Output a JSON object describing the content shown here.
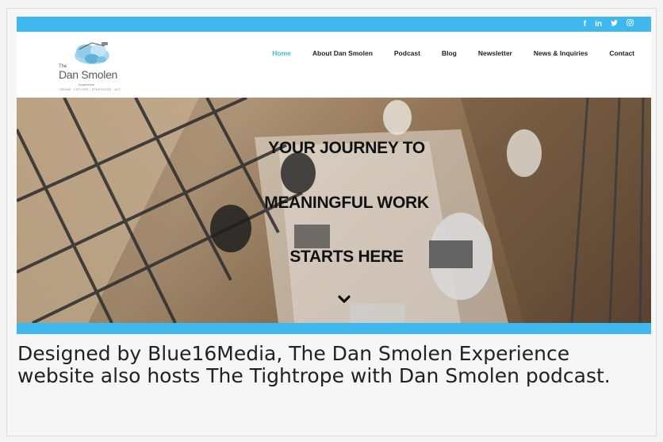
{
  "social": {
    "icons": [
      {
        "name": "facebook-icon",
        "glyph": "f"
      },
      {
        "name": "linkedin-icon",
        "glyph": "in"
      },
      {
        "name": "twitter-icon",
        "glyph": "🐦"
      },
      {
        "name": "instagram-icon",
        "glyph": "◎"
      }
    ]
  },
  "logo": {
    "the": "The",
    "name": "Dan Smolen",
    "sub": "Experience",
    "tagline": "DREAM · EXPLORE · STRATEGIZE · ACT"
  },
  "nav": {
    "items": [
      {
        "label": "Home",
        "active": true
      },
      {
        "label": "About Dan Smolen",
        "active": false
      },
      {
        "label": "Podcast",
        "active": false
      },
      {
        "label": "Blog",
        "active": false
      },
      {
        "label": "Newsletter",
        "active": false
      },
      {
        "label": "News & Inquiries",
        "active": false
      },
      {
        "label": "Contact",
        "active": false
      }
    ]
  },
  "hero": {
    "line1": "YOUR JOURNEY TO",
    "line2": "MEANINGFUL WORK",
    "line3": "STARTS HERE"
  },
  "caption": "Designed by Blue16Media, The Dan Smolen Experience website also hosts The Tightrope with Dan Smolen podcast.",
  "colors": {
    "accent": "#3fb8ee",
    "text": "#222222"
  }
}
